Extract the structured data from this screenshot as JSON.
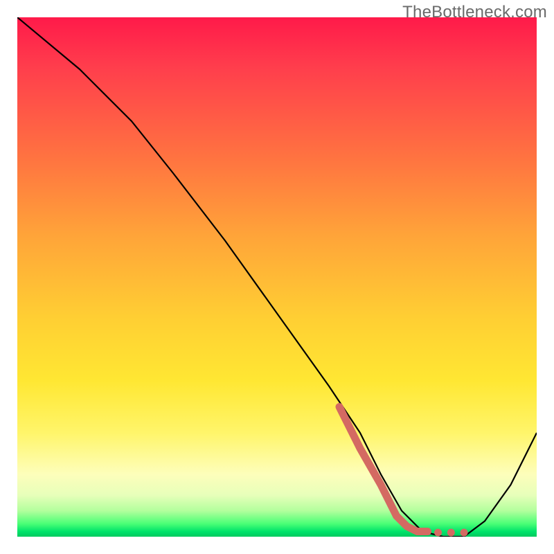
{
  "watermark": "TheBottleneck.com",
  "chart_data": {
    "type": "line",
    "title": "",
    "xlabel": "",
    "ylabel": "",
    "xlim": [
      0,
      100
    ],
    "ylim": [
      0,
      100
    ],
    "series": [
      {
        "name": "curve",
        "x": [
          0,
          12,
          22,
          30,
          40,
          50,
          60,
          66,
          70,
          74,
          78,
          82,
          86,
          90,
          95,
          100
        ],
        "y": [
          100,
          90,
          80,
          70,
          57,
          43,
          29,
          20,
          12,
          5,
          1,
          0,
          0,
          3,
          10,
          20
        ],
        "stroke": "#000000",
        "stroke_width": 2
      },
      {
        "name": "highlight",
        "x": [
          62,
          66,
          70,
          73,
          75,
          77,
          79
        ],
        "y": [
          25,
          17,
          10,
          4,
          2,
          1,
          1
        ],
        "stroke": "#d46a62",
        "stroke_width": 11,
        "style": "solid"
      },
      {
        "name": "highlight-dots",
        "x": [
          81,
          83.5,
          86
        ],
        "y": [
          0.8,
          0.8,
          0.8
        ],
        "stroke": "#d46a62",
        "stroke_width": 11,
        "style": "dotted"
      }
    ],
    "background_gradient": {
      "direction": "vertical",
      "stops": [
        {
          "pos": 0.0,
          "color": "#ff1a4a"
        },
        {
          "pos": 0.4,
          "color": "#ffa439"
        },
        {
          "pos": 0.7,
          "color": "#ffe733"
        },
        {
          "pos": 0.92,
          "color": "#e7ffba"
        },
        {
          "pos": 1.0,
          "color": "#00c95f"
        }
      ]
    }
  }
}
